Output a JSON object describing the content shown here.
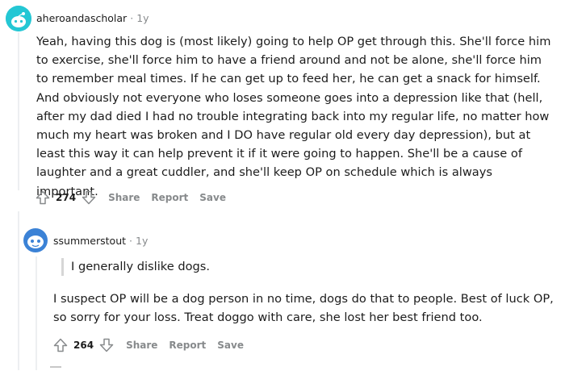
{
  "comments": [
    {
      "username": "aheroandascholar",
      "age": "1y",
      "body": "Yeah, having this dog is (most likely) going to help OP get through this. She'll force him to exercise, she'll force him to have a friend around and not be alone, she'll force him to remember meal times. If he can get up to feed her, he can get a snack for himself. And obviously not everyone who loses someone goes into a depression like that (hell, after my dad died I had no trouble integrating back into my regular life, no matter how much my heart was broken and I DO have regular old every day depression), but at least this way it can help prevent it if it were going to happen. She'll be a cause of laughter and a great cuddler, and she'll keep OP on schedule which is always important.",
      "score": "274",
      "avatar_color": "#24c7d4"
    },
    {
      "username": "ssummerstout",
      "age": "1y",
      "quote": "I generally dislike dogs.",
      "body": "I suspect OP will be a dog person in no time, dogs do that to people. Best of luck OP, so sorry for your loss. Treat doggo with care, she lost her best friend too.",
      "score": "264",
      "avatar_color": "#3b82d6"
    }
  ],
  "actions": {
    "share": "Share",
    "report": "Report",
    "save": "Save"
  },
  "separator": "·",
  "icons": {
    "upvote": "arrow-up-outline-icon",
    "downvote": "arrow-down-outline-icon"
  }
}
